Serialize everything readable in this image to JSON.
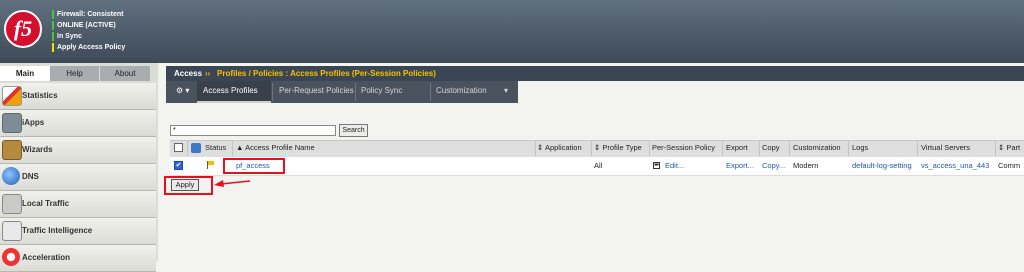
{
  "header": {
    "logo_text": "f5",
    "status_lines": [
      "Firewall: Consistent",
      "ONLINE (ACTIVE)",
      "In Sync",
      "Apply Access Policy"
    ]
  },
  "nav": {
    "tabs": [
      "Main",
      "Help",
      "About"
    ],
    "items": [
      {
        "label": "Statistics",
        "icon": "statistics-icon"
      },
      {
        "label": "iApps",
        "icon": "iapps-icon"
      },
      {
        "label": "Wizards",
        "icon": "wizards-icon"
      },
      {
        "label": "DNS",
        "icon": "dns-icon"
      },
      {
        "label": "Local Traffic",
        "icon": "local-traffic-icon"
      },
      {
        "label": "Traffic Intelligence",
        "icon": "traffic-intelligence-icon"
      },
      {
        "label": "Acceleration",
        "icon": "acceleration-icon"
      }
    ]
  },
  "breadcrumb": {
    "section": "Access",
    "separator": "››",
    "path": "Profiles / Policies : Access Profiles (Per-Session Policies)"
  },
  "subtabs": {
    "gear": "⚙ ▾",
    "items": [
      "Access Profiles",
      "Per-Request Policies",
      "Policy Sync",
      "Customization"
    ],
    "customization_arrow": "▾"
  },
  "search": {
    "value": "*",
    "button": "Search"
  },
  "table": {
    "headers": {
      "status": "Status",
      "name": "▲ Access Profile Name",
      "application": "⇕ Application",
      "profile_type": "⇕ Profile Type",
      "per_session_policy": "Per-Session Policy",
      "export": "Export",
      "copy": "Copy",
      "customization": "Customization",
      "logs": "Logs",
      "virtual_servers": "Virtual Servers",
      "partition": "⇕ Part"
    },
    "rows": [
      {
        "checked": "✔",
        "name": "pf_access",
        "application": "",
        "profile_type": "All",
        "per_session_policy": "Edit...",
        "export": "Export...",
        "copy": "Copy...",
        "customization": "Modern",
        "logs": "default-log-setting",
        "virtual_servers": "vs_access_una_443",
        "partition": "Comm"
      }
    ]
  },
  "apply_button": "Apply",
  "colors": {
    "accent_red": "#e8101c",
    "link_blue": "#1f57b8",
    "breadcrumb_yellow": "#f5c200",
    "status_green": "#3fc93f",
    "status_yellow": "#f2e400"
  }
}
